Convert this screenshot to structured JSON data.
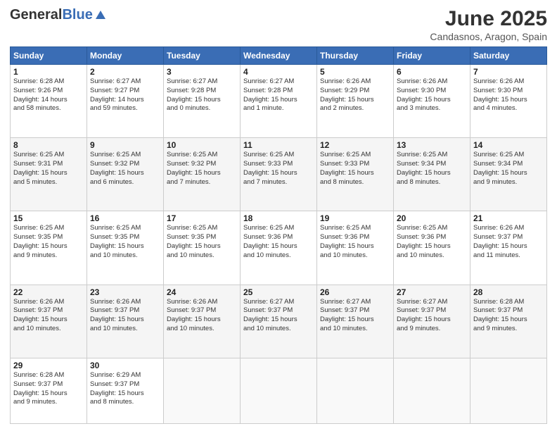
{
  "logo": {
    "general": "General",
    "blue": "Blue"
  },
  "title": "June 2025",
  "location": "Candasnos, Aragon, Spain",
  "days_of_week": [
    "Sunday",
    "Monday",
    "Tuesday",
    "Wednesday",
    "Thursday",
    "Friday",
    "Saturday"
  ],
  "weeks": [
    [
      {
        "day": "1",
        "info": "Sunrise: 6:28 AM\nSunset: 9:26 PM\nDaylight: 14 hours\nand 58 minutes."
      },
      {
        "day": "2",
        "info": "Sunrise: 6:27 AM\nSunset: 9:27 PM\nDaylight: 14 hours\nand 59 minutes."
      },
      {
        "day": "3",
        "info": "Sunrise: 6:27 AM\nSunset: 9:28 PM\nDaylight: 15 hours\nand 0 minutes."
      },
      {
        "day": "4",
        "info": "Sunrise: 6:27 AM\nSunset: 9:28 PM\nDaylight: 15 hours\nand 1 minute."
      },
      {
        "day": "5",
        "info": "Sunrise: 6:26 AM\nSunset: 9:29 PM\nDaylight: 15 hours\nand 2 minutes."
      },
      {
        "day": "6",
        "info": "Sunrise: 6:26 AM\nSunset: 9:30 PM\nDaylight: 15 hours\nand 3 minutes."
      },
      {
        "day": "7",
        "info": "Sunrise: 6:26 AM\nSunset: 9:30 PM\nDaylight: 15 hours\nand 4 minutes."
      }
    ],
    [
      {
        "day": "8",
        "info": "Sunrise: 6:25 AM\nSunset: 9:31 PM\nDaylight: 15 hours\nand 5 minutes."
      },
      {
        "day": "9",
        "info": "Sunrise: 6:25 AM\nSunset: 9:32 PM\nDaylight: 15 hours\nand 6 minutes."
      },
      {
        "day": "10",
        "info": "Sunrise: 6:25 AM\nSunset: 9:32 PM\nDaylight: 15 hours\nand 7 minutes."
      },
      {
        "day": "11",
        "info": "Sunrise: 6:25 AM\nSunset: 9:33 PM\nDaylight: 15 hours\nand 7 minutes."
      },
      {
        "day": "12",
        "info": "Sunrise: 6:25 AM\nSunset: 9:33 PM\nDaylight: 15 hours\nand 8 minutes."
      },
      {
        "day": "13",
        "info": "Sunrise: 6:25 AM\nSunset: 9:34 PM\nDaylight: 15 hours\nand 8 minutes."
      },
      {
        "day": "14",
        "info": "Sunrise: 6:25 AM\nSunset: 9:34 PM\nDaylight: 15 hours\nand 9 minutes."
      }
    ],
    [
      {
        "day": "15",
        "info": "Sunrise: 6:25 AM\nSunset: 9:35 PM\nDaylight: 15 hours\nand 9 minutes."
      },
      {
        "day": "16",
        "info": "Sunrise: 6:25 AM\nSunset: 9:35 PM\nDaylight: 15 hours\nand 10 minutes."
      },
      {
        "day": "17",
        "info": "Sunrise: 6:25 AM\nSunset: 9:35 PM\nDaylight: 15 hours\nand 10 minutes."
      },
      {
        "day": "18",
        "info": "Sunrise: 6:25 AM\nSunset: 9:36 PM\nDaylight: 15 hours\nand 10 minutes."
      },
      {
        "day": "19",
        "info": "Sunrise: 6:25 AM\nSunset: 9:36 PM\nDaylight: 15 hours\nand 10 minutes."
      },
      {
        "day": "20",
        "info": "Sunrise: 6:25 AM\nSunset: 9:36 PM\nDaylight: 15 hours\nand 10 minutes."
      },
      {
        "day": "21",
        "info": "Sunrise: 6:26 AM\nSunset: 9:37 PM\nDaylight: 15 hours\nand 11 minutes."
      }
    ],
    [
      {
        "day": "22",
        "info": "Sunrise: 6:26 AM\nSunset: 9:37 PM\nDaylight: 15 hours\nand 10 minutes."
      },
      {
        "day": "23",
        "info": "Sunrise: 6:26 AM\nSunset: 9:37 PM\nDaylight: 15 hours\nand 10 minutes."
      },
      {
        "day": "24",
        "info": "Sunrise: 6:26 AM\nSunset: 9:37 PM\nDaylight: 15 hours\nand 10 minutes."
      },
      {
        "day": "25",
        "info": "Sunrise: 6:27 AM\nSunset: 9:37 PM\nDaylight: 15 hours\nand 10 minutes."
      },
      {
        "day": "26",
        "info": "Sunrise: 6:27 AM\nSunset: 9:37 PM\nDaylight: 15 hours\nand 10 minutes."
      },
      {
        "day": "27",
        "info": "Sunrise: 6:27 AM\nSunset: 9:37 PM\nDaylight: 15 hours\nand 9 minutes."
      },
      {
        "day": "28",
        "info": "Sunrise: 6:28 AM\nSunset: 9:37 PM\nDaylight: 15 hours\nand 9 minutes."
      }
    ],
    [
      {
        "day": "29",
        "info": "Sunrise: 6:28 AM\nSunset: 9:37 PM\nDaylight: 15 hours\nand 9 minutes."
      },
      {
        "day": "30",
        "info": "Sunrise: 6:29 AM\nSunset: 9:37 PM\nDaylight: 15 hours\nand 8 minutes."
      },
      {
        "day": "",
        "info": ""
      },
      {
        "day": "",
        "info": ""
      },
      {
        "day": "",
        "info": ""
      },
      {
        "day": "",
        "info": ""
      },
      {
        "day": "",
        "info": ""
      }
    ]
  ]
}
